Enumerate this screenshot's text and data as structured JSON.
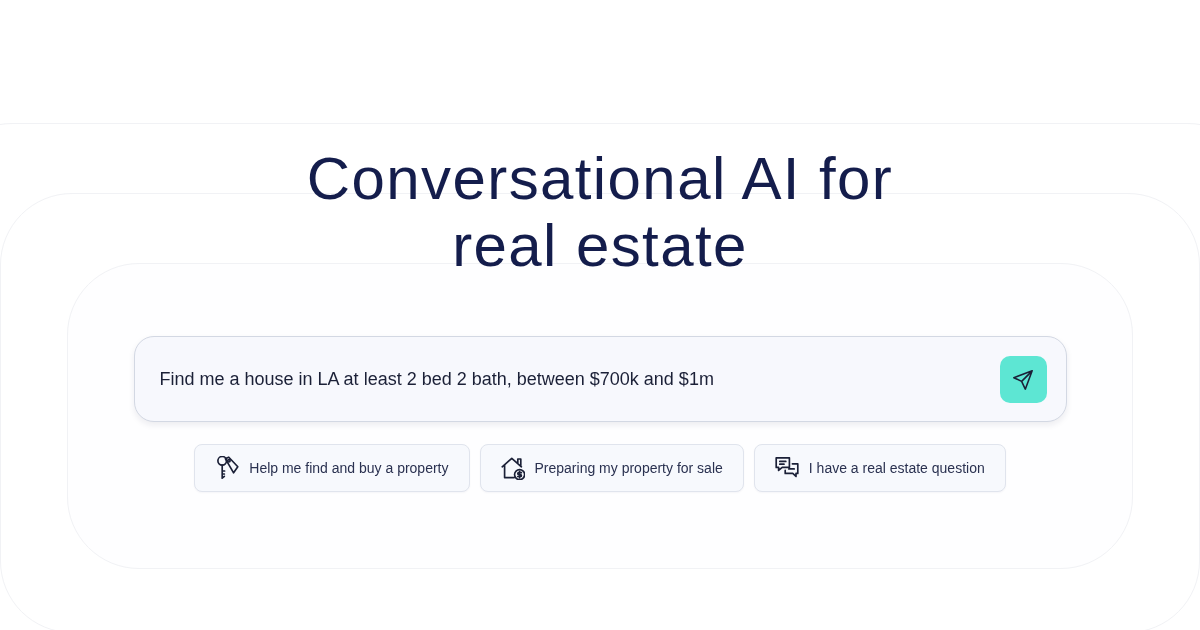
{
  "heading": "Conversational AI for real estate",
  "chat_input": {
    "value": "Find me a house in LA at least 2 bed 2 bath, between $700k and $1m"
  },
  "suggestions": [
    {
      "kind": "keys",
      "label": "Help me find and buy a property"
    },
    {
      "kind": "house",
      "label": "Preparing my property for sale"
    },
    {
      "kind": "chat",
      "label": "I have a real estate question"
    }
  ]
}
